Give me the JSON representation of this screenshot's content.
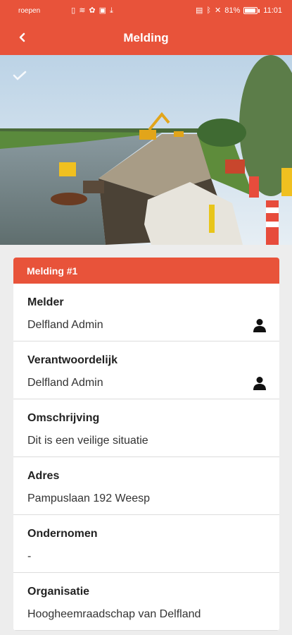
{
  "status_bar": {
    "carrier": "roepen",
    "battery": "81%",
    "time": "11:01"
  },
  "app_bar": {
    "title": "Melding"
  },
  "photo": {
    "description_icon": "checkmark-icon"
  },
  "card": {
    "header": "Melding #1",
    "fields": [
      {
        "label": "Melder",
        "value": "Delfland Admin",
        "icon": "person-icon"
      },
      {
        "label": "Verantwoordelijk",
        "value": "Delfland Admin",
        "icon": "person-icon"
      },
      {
        "label": "Omschrijving",
        "value": "Dit is een veilige situatie"
      },
      {
        "label": "Adres",
        "value": "Pampuslaan 192 Weesp"
      },
      {
        "label": "Ondernomen",
        "value": "-"
      },
      {
        "label": "Organisatie",
        "value": "Hoogheemraadschap van Delfland"
      }
    ]
  },
  "colors": {
    "accent": "#e8533a",
    "background": "#ededed"
  }
}
